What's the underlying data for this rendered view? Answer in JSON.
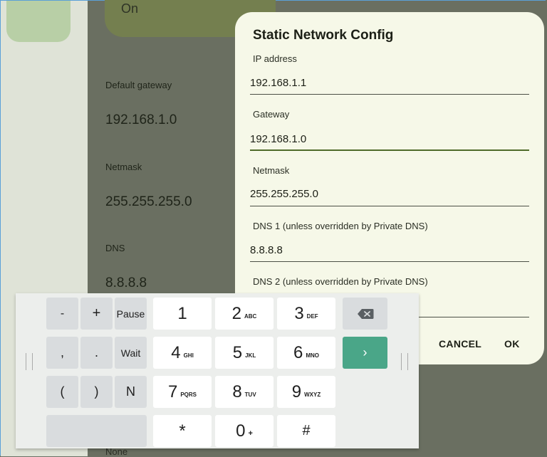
{
  "settings": {
    "on_text": "On",
    "gateway_label": "Default gateway",
    "gateway_value": "192.168.1.0",
    "netmask_label": "Netmask",
    "netmask_value": "255.255.255.0",
    "dns_label": "DNS",
    "dns_value": "8.8.8.8",
    "none_text": "None"
  },
  "dialog": {
    "title": "Static Network Config",
    "fields": [
      {
        "label": "IP address",
        "value": "192.168.1.1"
      },
      {
        "label": "Gateway",
        "value": "192.168.1.0"
      },
      {
        "label": "Netmask",
        "value": "255.255.255.0"
      },
      {
        "label": "DNS 1 (unless overridden by Private DNS)",
        "value": "8.8.8.8"
      },
      {
        "label": "DNS 2 (unless overridden by Private DNS)",
        "value": ""
      }
    ],
    "cancel_label": "CANCEL",
    "ok_label": "OK"
  },
  "keypad": {
    "minus": "-",
    "plus": "+",
    "pause": "Pause",
    "comma": ",",
    "period": ".",
    "wait": "Wait",
    "lparen": "(",
    "rparen": ")",
    "n": "N",
    "k1": "1",
    "k2": "2",
    "k2s": "ABC",
    "k3": "3",
    "k3s": "DEF",
    "k4": "4",
    "k4s": "GHI",
    "k5": "5",
    "k5s": "JKL",
    "k6": "6",
    "k6s": "MNO",
    "k7": "7",
    "k7s": "PQRS",
    "k8": "8",
    "k8s": "TUV",
    "k9": "9",
    "k9s": "WXYZ",
    "star": "*",
    "k0": "0",
    "k0s": "+",
    "hash": "#",
    "next_glyph": "›",
    "icons": {
      "delete": "backspace-icon",
      "next": "chevron-right-icon"
    }
  },
  "colors": {
    "accent": "#4aa688",
    "dialog_bg": "#f6f8e8",
    "active_line": "#4f6b2a"
  }
}
